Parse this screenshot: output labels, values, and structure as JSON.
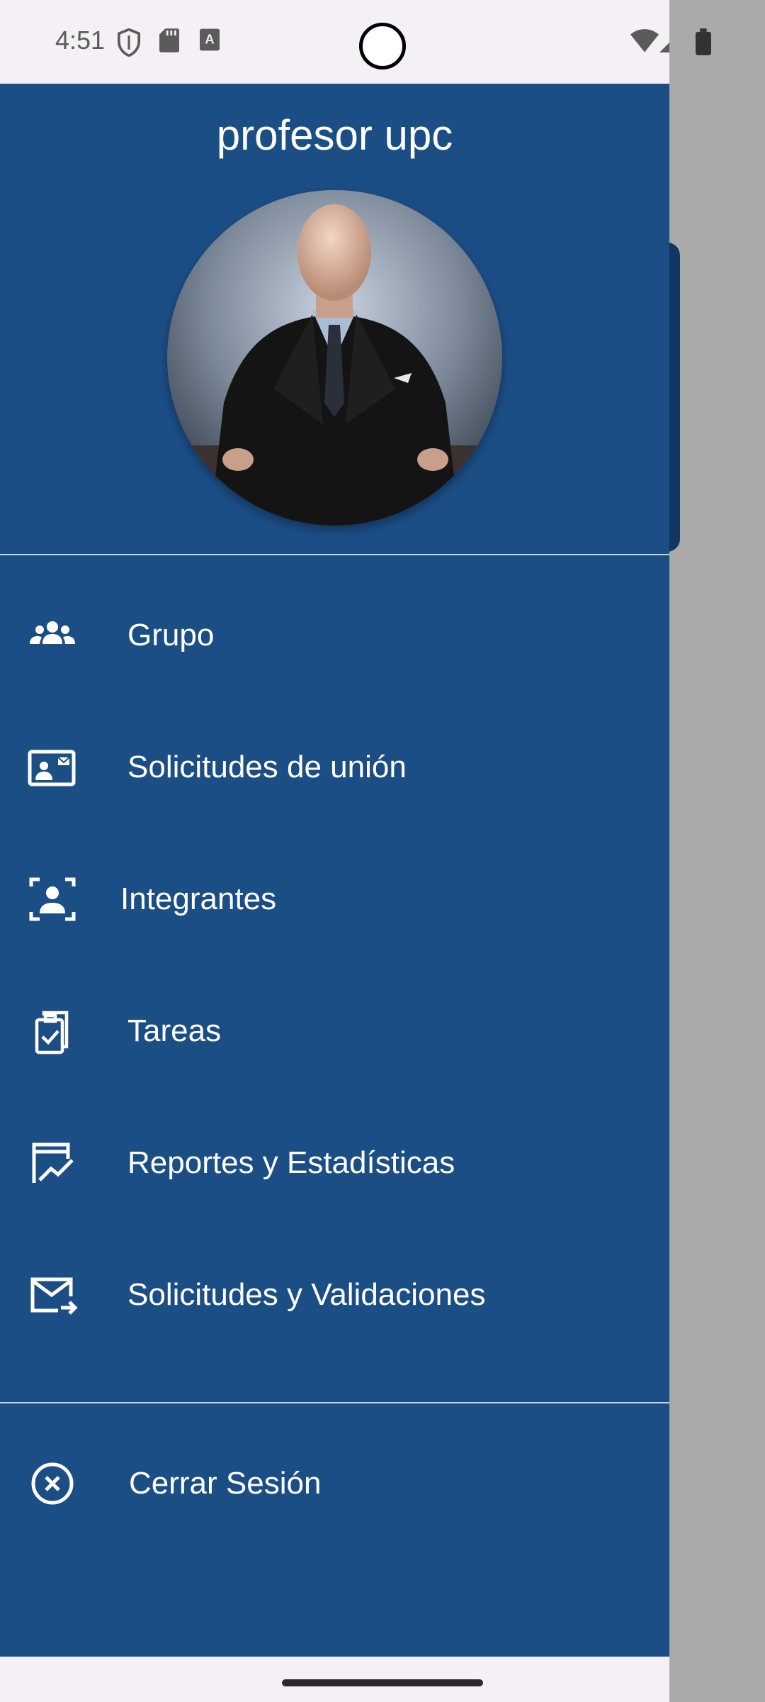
{
  "status_bar": {
    "time": "4:51",
    "left_icons": [
      "shield-icon",
      "sd-card-icon",
      "keyboard-a-icon"
    ],
    "right_icons": [
      "wifi-icon",
      "cell-signal-icon",
      "battery-icon"
    ]
  },
  "header": {
    "profile_name": "profesor upc"
  },
  "menu": {
    "items": [
      {
        "label": "Grupo",
        "icon": "group-icon"
      },
      {
        "label": "Solicitudes de unión",
        "icon": "contact-card-mail-icon"
      },
      {
        "label": "Integrantes",
        "icon": "person-frame-icon"
      },
      {
        "label": "Tareas",
        "icon": "clipboard-check-icon"
      },
      {
        "label": "Reportes y Estadísticas",
        "icon": "report-chart-icon"
      },
      {
        "label": "Solicitudes y Validaciones",
        "icon": "mail-forward-icon"
      }
    ],
    "logout": {
      "label": "Cerrar Sesión",
      "icon": "close-circle-icon"
    }
  },
  "colors": {
    "drawer_bg": "#1c4e86",
    "scrim": "#aaaaaa",
    "status_bar_bg": "#f4f0f6",
    "text": "#ffffff"
  }
}
